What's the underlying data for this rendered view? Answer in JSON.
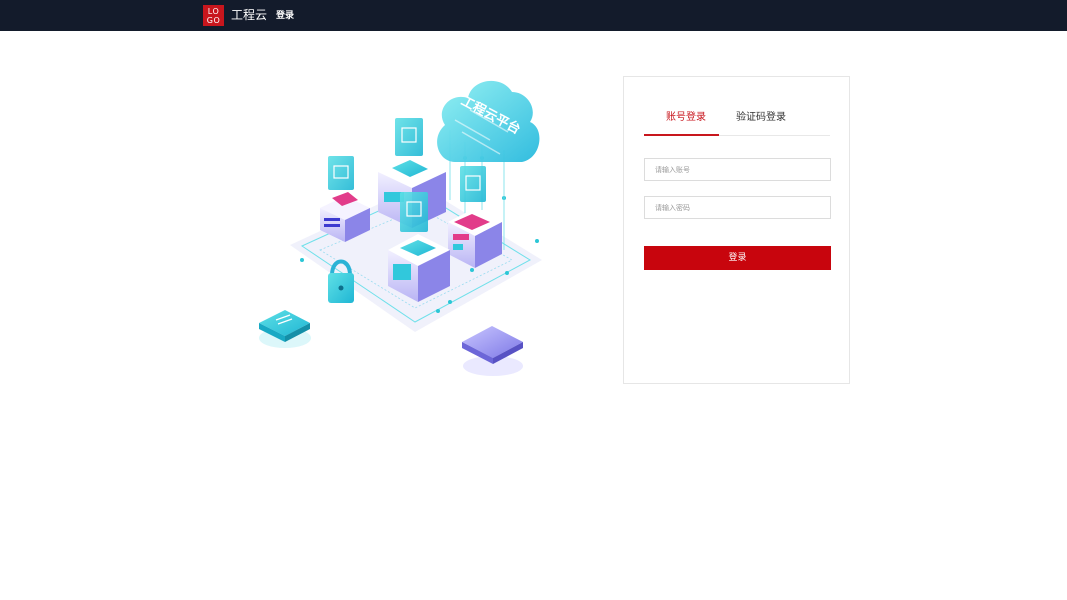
{
  "header": {
    "logo_line1": "LO",
    "logo_line2": "GO",
    "brand_name": "工程云",
    "nav_login": "登录"
  },
  "illustration": {
    "cloud_text": "工程云平台"
  },
  "login": {
    "tabs": [
      {
        "label": "账号登录",
        "active": true
      },
      {
        "label": "验证码登录",
        "active": false
      }
    ],
    "account_placeholder": "请输入账号",
    "password_placeholder": "请输入密码",
    "submit_label": "登录"
  },
  "colors": {
    "accent": "#c8161d",
    "header_bg": "#131b2b",
    "illustration_teal": "#2bc6d6",
    "illustration_purple": "#8a86e8"
  }
}
